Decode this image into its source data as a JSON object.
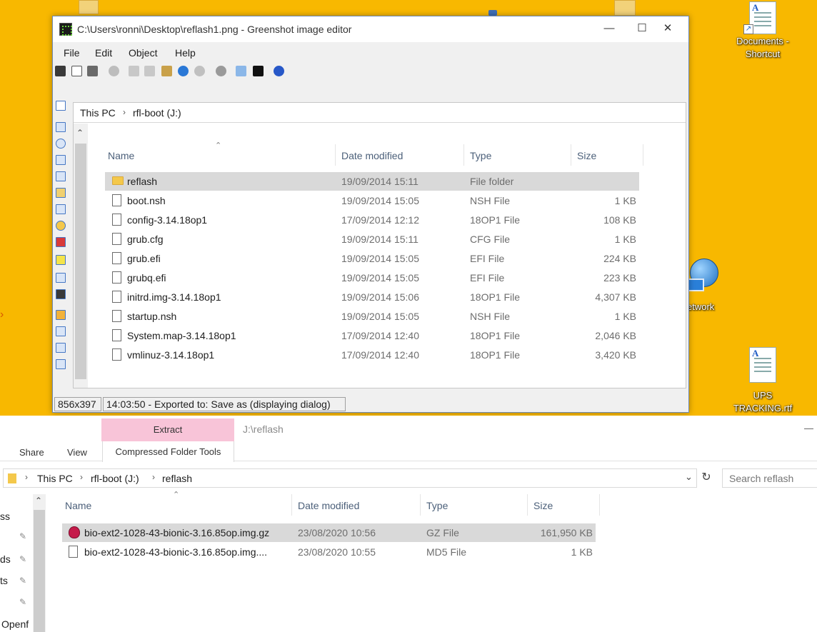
{
  "desktop": {
    "icons": [
      {
        "label_line1": "Documents -",
        "label_line2": "Shortcut"
      },
      {
        "label_line1": "etwork",
        "label_line2": ""
      },
      {
        "label_line1": "UPS",
        "label_line2": "TRACKING.rtf"
      }
    ]
  },
  "greenshot": {
    "title": "C:\\Users\\ronni\\Desktop\\reflash1.png - Greenshot image editor",
    "window_buttons": {
      "minimize": "—",
      "maximize": "☐",
      "close": "✕"
    },
    "menu": [
      "File",
      "Edit",
      "Object",
      "Help"
    ],
    "status": {
      "dimensions": "856x397",
      "message": "14:03:50 - Exported to: Save as (displaying dialog)"
    },
    "image": {
      "breadcrumb": [
        "This PC",
        "rfl-boot (J:)"
      ],
      "columns": [
        "Name",
        "Date modified",
        "Type",
        "Size"
      ],
      "rows": [
        {
          "name": "reflash",
          "date": "19/09/2014 15:11",
          "type": "File folder",
          "size": "",
          "kind": "folder"
        },
        {
          "name": "boot.nsh",
          "date": "19/09/2014 15:05",
          "type": "NSH File",
          "size": "1 KB",
          "kind": "file"
        },
        {
          "name": "config-3.14.18op1",
          "date": "17/09/2014 12:12",
          "type": "18OP1 File",
          "size": "108 KB",
          "kind": "file"
        },
        {
          "name": "grub.cfg",
          "date": "19/09/2014 15:11",
          "type": "CFG File",
          "size": "1 KB",
          "kind": "file"
        },
        {
          "name": "grub.efi",
          "date": "19/09/2014 15:05",
          "type": "EFI File",
          "size": "224 KB",
          "kind": "file"
        },
        {
          "name": "grubq.efi",
          "date": "19/09/2014 15:05",
          "type": "EFI File",
          "size": "223 KB",
          "kind": "file"
        },
        {
          "name": "initrd.img-3.14.18op1",
          "date": "19/09/2014 15:06",
          "type": "18OP1 File",
          "size": "4,307 KB",
          "kind": "file"
        },
        {
          "name": "startup.nsh",
          "date": "19/09/2014 15:05",
          "type": "NSH File",
          "size": "1 KB",
          "kind": "file"
        },
        {
          "name": "System.map-3.14.18op1",
          "date": "17/09/2014 12:40",
          "type": "18OP1 File",
          "size": "2,046 KB",
          "kind": "file"
        },
        {
          "name": "vmlinuz-3.14.18op1",
          "date": "17/09/2014 12:40",
          "type": "18OP1 File",
          "size": "3,420 KB",
          "kind": "file"
        }
      ]
    }
  },
  "explorer": {
    "ribbon": {
      "extract_tab": "Extract",
      "path_title": "J:\\reflash",
      "tabs": [
        "Share",
        "View"
      ],
      "compressed_tools": "Compressed Folder Tools"
    },
    "breadcrumb": [
      "This PC",
      "rfl-boot (J:)",
      "reflash"
    ],
    "search_placeholder": "Search reflash",
    "nav_fragments": [
      "ss",
      "ds",
      "ts",
      "Openf"
    ],
    "columns": [
      "Name",
      "Date modified",
      "Type",
      "Size"
    ],
    "rows": [
      {
        "name": "bio-ext2-1028-43-bionic-3.16.85op.img.gz",
        "date": "23/08/2020 10:56",
        "type": "GZ File",
        "size": "161,950 KB",
        "kind": "raspberry"
      },
      {
        "name": "bio-ext2-1028-43-bionic-3.16.85op.img....",
        "date": "23/08/2020 10:55",
        "type": "MD5 File",
        "size": "1 KB",
        "kind": "file"
      }
    ]
  },
  "colors": {
    "desktop": "#f8b800",
    "extract_tab": "#f8c4d8",
    "selected_row": "#d9d9d9"
  }
}
